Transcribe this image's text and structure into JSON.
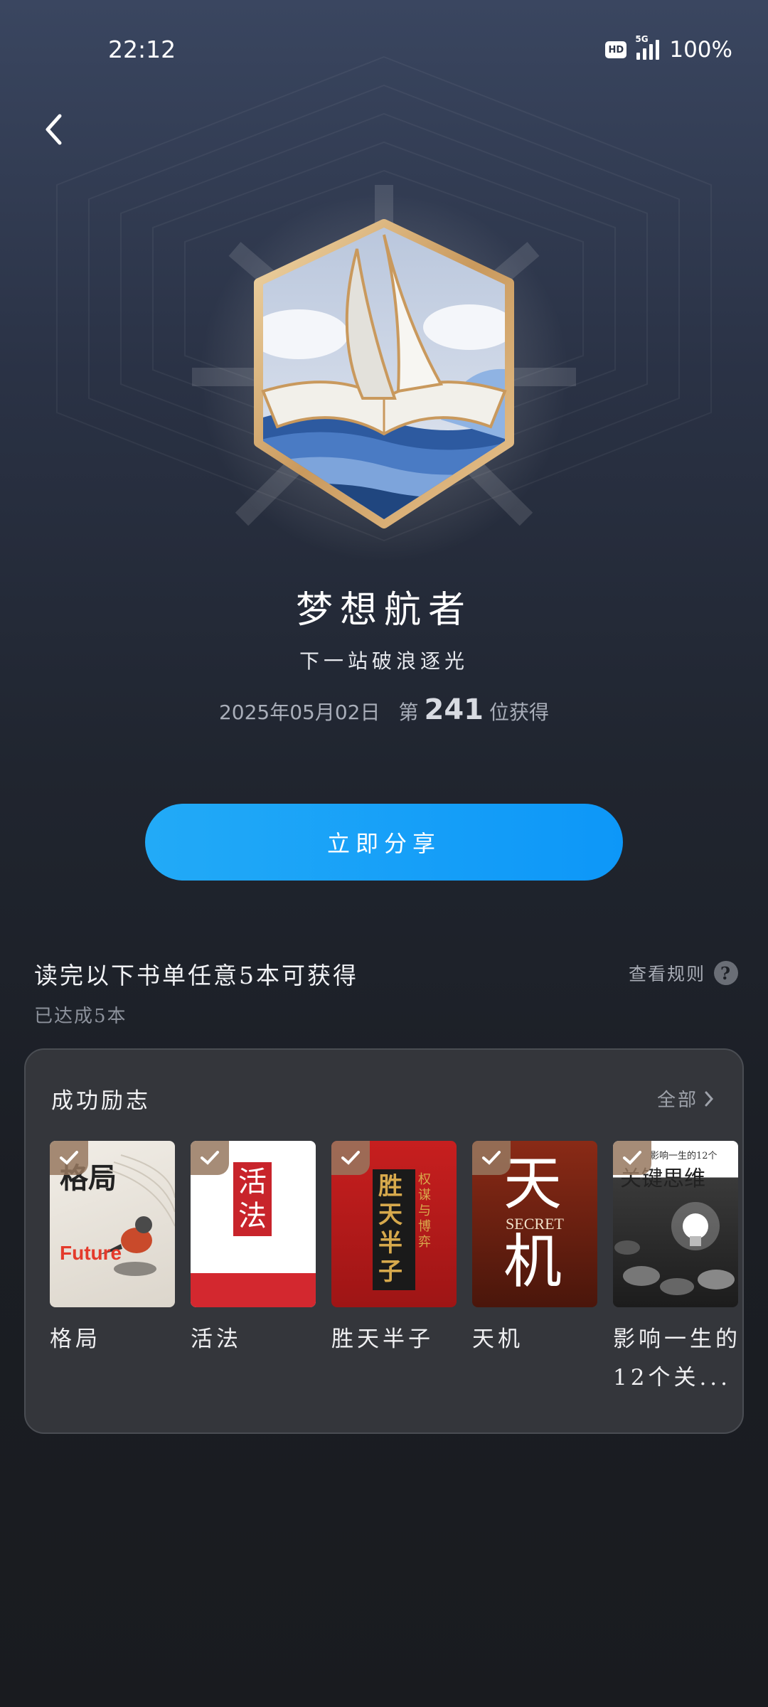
{
  "status_bar": {
    "time": "22:12",
    "network": "5G",
    "hd": "HD",
    "battery": "100%"
  },
  "badge": {
    "name": "梦想航者",
    "subtitle": "下一站破浪逐光",
    "date": "2025年05月02日",
    "rank_prefix": "第",
    "rank": "241",
    "rank_suffix": "位获得"
  },
  "share_button": {
    "label": "立即分享"
  },
  "task": {
    "title": "读完以下书单任意5本可获得",
    "progress": "已达成5本",
    "rules_label": "查看规则",
    "help_glyph": "?"
  },
  "booklist": {
    "title": "成功励志",
    "see_all": "全部",
    "books": [
      {
        "title": "格局",
        "cover_text": "格局",
        "cover_subtext": "Future",
        "completed": true
      },
      {
        "title": "活法",
        "cover_text": "活法",
        "completed": true
      },
      {
        "title": "胜天半子",
        "cover_text": "胜天半子",
        "cover_subtext": "权谋与博弈",
        "completed": true
      },
      {
        "title": "天机",
        "cover_text": "天机",
        "cover_subtext": "SECRET",
        "completed": true
      },
      {
        "title": "影响一生的12个关...",
        "cover_text": "关键思维",
        "cover_subtext": "影响一生的12个",
        "completed": true
      }
    ]
  },
  "colors": {
    "accent_blue": "#0d97f8",
    "card_bg": "#34363b",
    "medal_gold": "#d8b27a"
  }
}
